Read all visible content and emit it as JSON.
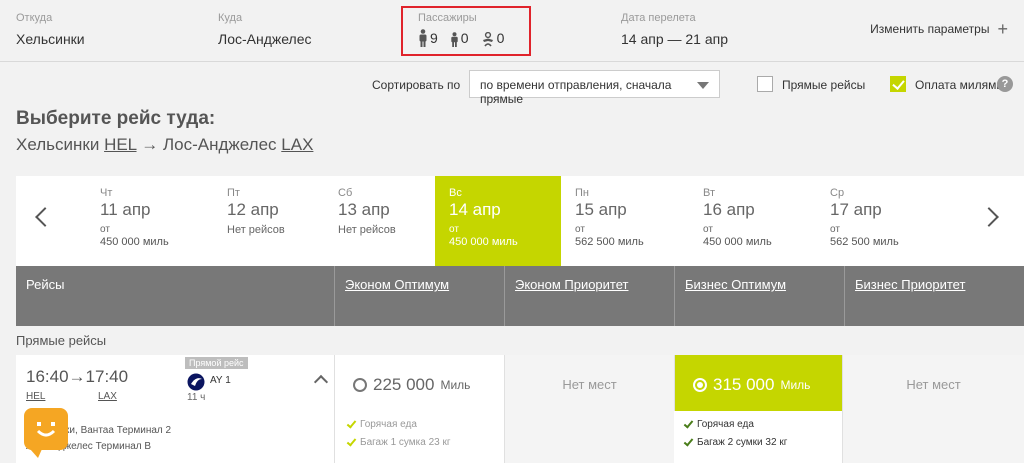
{
  "search": {
    "from_label": "Откуда",
    "from_value": "Хельсинки",
    "to_label": "Куда",
    "to_value": "Лос-Анджелес",
    "pax_label": "Пассажиры",
    "adults": "9",
    "children": "0",
    "infants": "0",
    "date_label": "Дата перелета",
    "date_value": "14 апр — 21 апр",
    "change_label": "Изменить параметры"
  },
  "sort": {
    "label": "Сортировать по",
    "selected": "по времени отправления, сначала прямые",
    "direct_label": "Прямые рейсы",
    "direct_checked": false,
    "miles_label": "Оплата милями",
    "miles_checked": true,
    "help": "?"
  },
  "heading": {
    "title": "Выберите рейс туда:",
    "from_city": "Хельсинки",
    "from_code": "HEL",
    "arrow": "→",
    "to_city": "Лос-Анджелес",
    "to_code": "LAX"
  },
  "dates": [
    {
      "dow": "Чт",
      "date": "11 апр",
      "from": "от",
      "price": "450 000 миль",
      "none": ""
    },
    {
      "dow": "Пт",
      "date": "12 апр",
      "from": "",
      "price": "",
      "none": "Нет рейсов"
    },
    {
      "dow": "Сб",
      "date": "13 апр",
      "from": "",
      "price": "",
      "none": "Нет рейсов"
    },
    {
      "dow": "Вс",
      "date": "14 апр",
      "from": "от",
      "price": "450 000 миль",
      "none": ""
    },
    {
      "dow": "Пн",
      "date": "15 апр",
      "from": "от",
      "price": "562 500 миль",
      "none": ""
    },
    {
      "dow": "Вт",
      "date": "16 апр",
      "from": "от",
      "price": "450 000 миль",
      "none": ""
    },
    {
      "dow": "Ср",
      "date": "17 апр",
      "from": "от",
      "price": "562 500 миль",
      "none": ""
    }
  ],
  "columns": {
    "flights": "Рейсы",
    "eco_opt": "Эконом Оптимум",
    "eco_pri": "Эконом Приоритет",
    "biz_opt": "Бизнес Оптимум",
    "biz_pri": "Бизнес Приоритет"
  },
  "section": "Прямые рейсы",
  "flight": {
    "dep_time": "16:40",
    "arrow": "→",
    "arr_time": "17:40",
    "dep_code": "HEL",
    "arr_code": "LAX",
    "badge": "Прямой рейс",
    "number": "AY 1",
    "duration": "11 ч",
    "dep_terminal": "Хельсинки, Вантаа Терминал 2",
    "arr_terminal": "Лос-Анджелес Терминал B",
    "eco_opt_price": "225 000",
    "miles": "Миль",
    "eco_opt_perk1": "Горячая еда",
    "eco_opt_perk2": "Багаж 1 сумка 23 кг",
    "eco_pri_status": "Нет мест",
    "biz_opt_price": "315 000",
    "biz_opt_perk1": "Горячая еда",
    "biz_opt_perk2": "Багаж 2 сумки 32 кг",
    "biz_pri_status": "Нет мест"
  }
}
